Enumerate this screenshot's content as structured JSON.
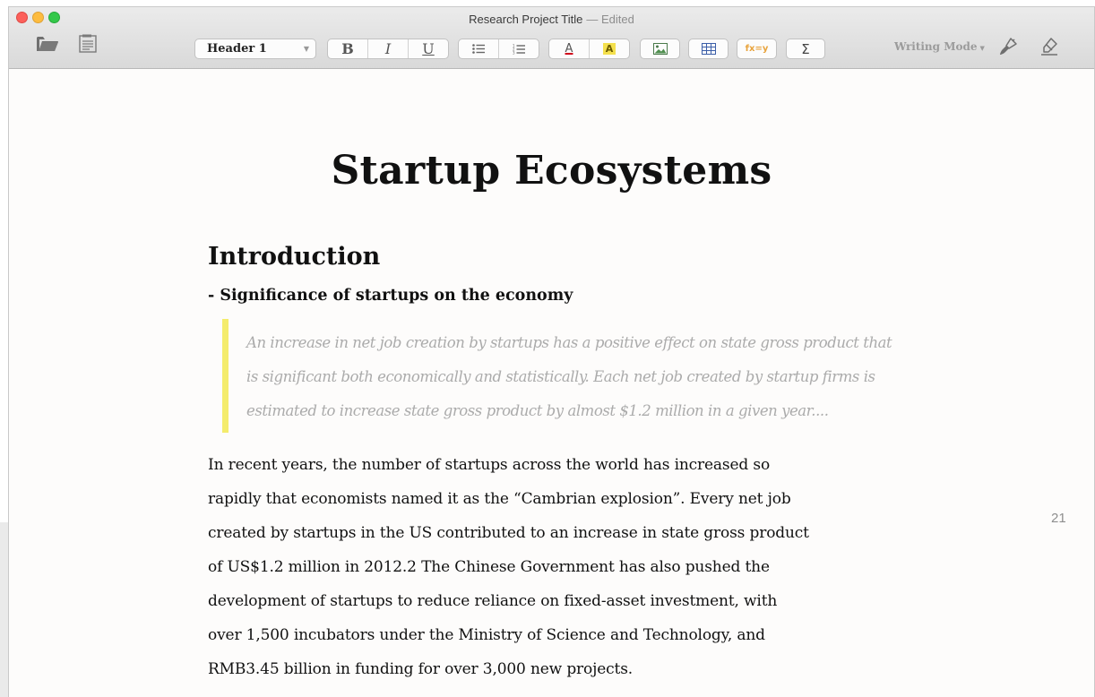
{
  "window": {
    "title": "Research Project Title",
    "edited": "— Edited"
  },
  "toolbar": {
    "style_select": "Header 1",
    "bold": "B",
    "italic": "I",
    "underline": "U",
    "text_color": "A",
    "highlight": "A",
    "formula": "fx=y",
    "sum": "Σ",
    "writing_mode": "Writing Mode",
    "icons": [
      "folder-open-icon",
      "document-list-icon",
      "bullet-list-icon",
      "numbered-list-icon",
      "image-icon",
      "table-icon",
      "brush-icon",
      "highlighter-icon"
    ]
  },
  "colors": {
    "quote_bar": "#f4ec6c",
    "highlight": "#f4e04d",
    "text_color_underline": "#d0021b",
    "formula": "#e8a33d"
  },
  "document": {
    "title": "Startup Ecosystems",
    "heading": "Introduction",
    "subheading": "- Significance of startups on the economy",
    "quote_lines": [
      "An increase in net job creation by startups has a positive effect on state gross product that",
      "is significant both economically and statistically. Each net job created by startup firms is",
      "estimated to increase state gross product by almost $1.2 million in a given year...."
    ],
    "body_lines": [
      "In recent years, the number of startups across the world has increased so",
      "rapidly that economists named it as the “Cambrian explosion”. Every net job",
      "created by startups in the US contributed to an increase in state gross product",
      "of US$1.2 million in 2012.2 The Chinese Government has also pushed the",
      "development of startups to reduce reliance on fixed-asset investment, with",
      "over 1,500 incubators under the Ministry of Science and Technology, and",
      "RMB3.45 billion in funding for over 3,000 new projects."
    ],
    "page_number": "21"
  }
}
